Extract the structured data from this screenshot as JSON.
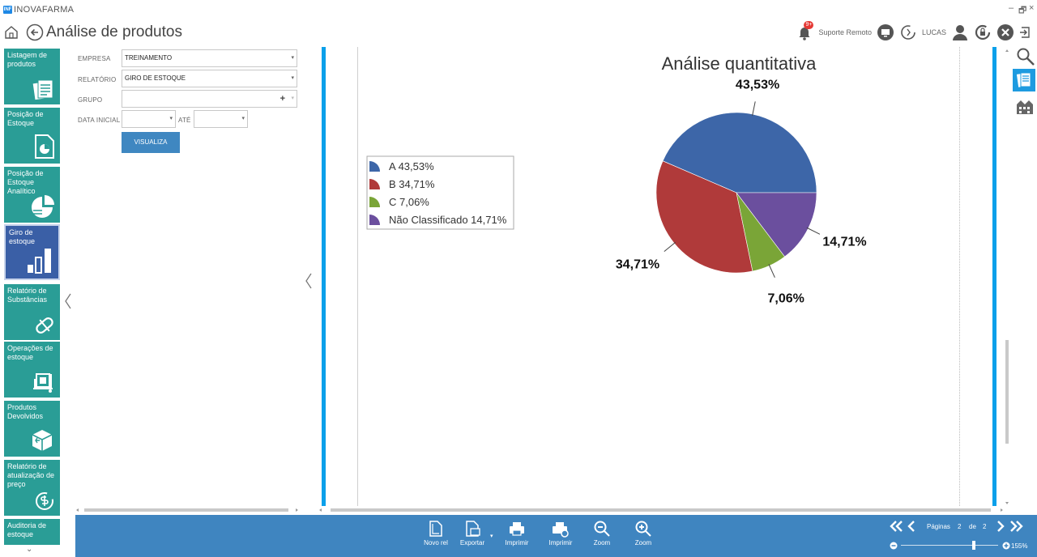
{
  "app": {
    "logo_text": "INF",
    "name": "INOVAFARMA"
  },
  "window_controls": {
    "minimize": "–",
    "restore": "🗗",
    "close": "×"
  },
  "header": {
    "page_title": "Análise de produtos",
    "notification_badge": "9+",
    "remote_support_label": "Suporte Remoto",
    "user_name": "LUCAS"
  },
  "nav": {
    "items": [
      {
        "label": "Listagem de produtos",
        "icon": "product-list-icon"
      },
      {
        "label": "Posição de Estoque",
        "icon": "stock-position-icon"
      },
      {
        "label": "Posição de Estoque Analítico",
        "icon": "pie-analysis-icon"
      },
      {
        "label": "Giro de estoque",
        "icon": "bar-chart-icon",
        "active": true
      },
      {
        "label": "Relatório de Substâncias",
        "icon": "pill-icon"
      },
      {
        "label": "Operações de estoque",
        "icon": "stock-operations-icon"
      },
      {
        "label": "Produtos Devolvidos",
        "icon": "returned-box-icon"
      },
      {
        "label": "Relatório de atualização de preço",
        "icon": "price-update-icon"
      },
      {
        "label": "Auditoria de estoque",
        "icon": "audit-icon"
      }
    ],
    "more_symbol": "⌄"
  },
  "form": {
    "empresa_label": "EMPRESA",
    "empresa_value": "TREINAMENTO",
    "relatorio_label": "RELATÓRIO",
    "relatorio_value": "GIRO DE ESTOQUE",
    "grupo_label": "GRUPO",
    "grupo_value": "",
    "grupo_add": "+",
    "data_inicial_label": "DATA INICIAL",
    "ate_label": "ATÉ",
    "visualiza_label": "VISUALIZA",
    "dropdown_arrow": "▾"
  },
  "chart_data": {
    "type": "pie",
    "title": "Análise quantitativa",
    "slices": [
      {
        "name": "A",
        "value": 43.53,
        "label": "43,53%",
        "legend": "A 43,53%",
        "color": "#3d66a8"
      },
      {
        "name": "B",
        "value": 34.71,
        "label": "34,71%",
        "legend": "B 34,71%",
        "color": "#b03a3a"
      },
      {
        "name": "C",
        "value": 7.06,
        "label": "7,06%",
        "legend": "C 7,06%",
        "color": "#7aa537"
      },
      {
        "name": "Não Classificado",
        "value": 14.71,
        "label": "14,71%",
        "legend": "Não Classificado 14,71%",
        "color": "#6b4f9e"
      }
    ],
    "legend_position": "left"
  },
  "toolbar": {
    "novo_rel": "Novo rel",
    "exportar": "Exportar",
    "imprimir_1": "Imprimir",
    "imprimir_2": "Imprimir",
    "zoom_out": "Zoom",
    "zoom_in": "Zoom"
  },
  "pager": {
    "label": "Páginas",
    "current": "2",
    "of": "de",
    "total": "2",
    "zoom_level": "155%",
    "zoom_fraction": 0.75
  },
  "colors": {
    "nav_tile": "#2a9d96",
    "nav_active": "#3a5fa6",
    "toolbar": "#3f85c0",
    "report_border": "#0aa0ea"
  }
}
